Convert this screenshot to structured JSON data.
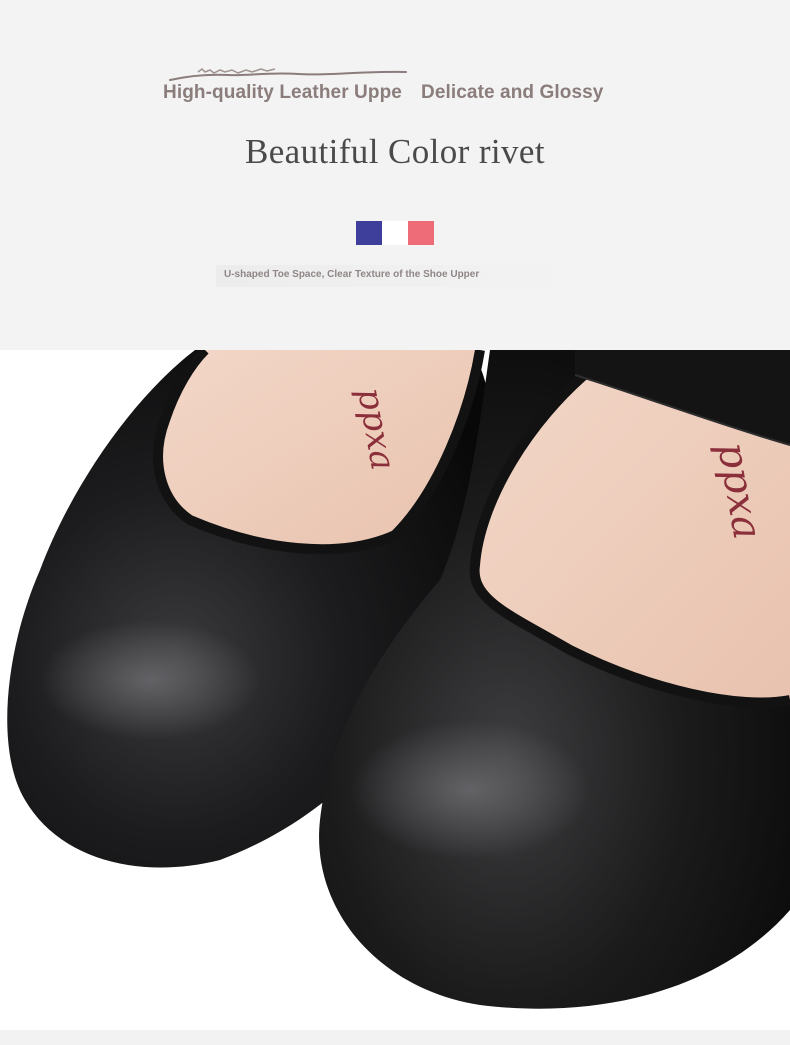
{
  "header": {
    "tagline_left": "High-quality Leather Uppe",
    "tagline_right": "Delicate and Glossy",
    "title": "Beautiful Color rivet",
    "subtitle": "U-shaped Toe Space, Clear Texture of the Shoe Upper"
  },
  "swatches": [
    {
      "name": "blue",
      "color": "#3d3f9a"
    },
    {
      "name": "white",
      "color": "#ffffff"
    },
    {
      "name": "pink",
      "color": "#ee6b78"
    }
  ],
  "photo": {
    "subject": "black-leather-mary-jane-shoes",
    "insole_logo": "ppxa"
  }
}
